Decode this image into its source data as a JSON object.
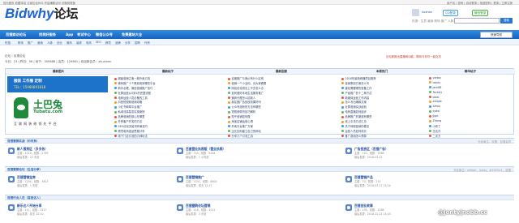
{
  "topbar": {
    "left": "设为首页  收藏本站  订阅论坛RSS  开启辅助访问  切换到宽版",
    "right": "用户名  |  密码  |  自动登录  |  找回密码  |  登录  |  立即注册"
  },
  "logo": {
    "brand": "Bidwhy",
    "suffix": "论坛"
  },
  "header_actions": {
    "qq_login": "QQ登录",
    "wechat_login": "微信登录",
    "hot_search": "热搜：生意 营销 职场 推广 人脉",
    "search_label": "搜索",
    "user": "liuxhon"
  },
  "nav": {
    "items": [
      "百搜商访论坛",
      "找到好服务",
      "App",
      "考试中心",
      "微信公众号",
      "免费建站大全"
    ],
    "right_button": "快速导航"
  },
  "subnav": {
    "items": [
      "热搜：",
      "职场",
      "推广",
      "营销",
      "人脉",
      "创业",
      "微商",
      "装修",
      "电商",
      "SEO",
      "跨境",
      "品牌",
      "分享",
      "招聘",
      "外贸"
    ]
  },
  "breadcrumb": "论坛 › 百搜论坛",
  "stats": "今日：23  |  昨日：56  |  帖子：309888  |  会员：129861  |  欢迎新会员：zhuichen",
  "right_notice": "论坛新推出直播间功能，期待与你们一起交流",
  "panel": {
    "col1": "最新图片",
    "col2": "最新帖子",
    "col3": "最新回复",
    "col4": "本周热门",
    "col5": "精华帖子",
    "ad_title": "服装 工作服 定制",
    "ad_phone": "TEL：15980891818",
    "brand_cn": "土巴兔",
    "brand_en": "Tubatu.com",
    "brand_slogan": "互 联 网 装 修 领 先 平 台"
  },
  "latest_posts": [
    "超级营销之第一款外卖引流",
    "微商推广十个策划用到哪些平台",
    "新手必看，微信营销推广技巧",
    "社群运营从0到1的完整流程",
    "电商运营人员必备的工具",
    "抖音短视频营销攻略",
    "小红书种草平台推广",
    "私域流量裂变实操案例",
    "品牌营销的核心在哪里",
    "外贸客户开发的方法",
    "SEO优化关键词布局技巧",
    "跨境电商选品思路分享",
    "线下门店引流的几种玩法"
  ],
  "latest_replies": [
    "百度推广与竞价有什么区别",
    "营销一个小活动，请大家看看",
    "网站优化排名上不去怎么办",
    "如何做好本地生活服务推广",
    "微商代理怎么招到人",
    "朋友圈广告投放效果好吗",
    "公众号涨粉的方法有哪些",
    "短视频带货技巧解析",
    "知乎营销如何做",
    "淘宝店铺运营心得",
    "外卖平台推广方案",
    "企业如何建立自己的网站",
    "分享几个引流工具"
  ],
  "weekly_hot": [
    "2018年最新网赚项目推荐",
    "营销策划方案怎么写",
    "建站需要哪些准备工作",
    "产品推广的十二种方法",
    "新媒体运营工作内容",
    "怎么写出爆款文案",
    "社群营销实战经验",
    "电商直播如何起步",
    "品牌推广的渠道有哪些",
    "线上引流方法汇总",
    "关于网络营销的看法",
    "运营人员如何成长",
    "推广费用怎么预算"
  ],
  "featured": [
    "yanbo",
    "tatyty",
    "jack88",
    "Tech01",
    "ideal",
    "zshjwe",
    "zzhou",
    "sydw",
    "jjppl",
    "Zhang",
    "小布丁",
    "无名氏",
    "二次方"
  ],
  "sections": [
    {
      "title": "百搜营销实战（中关系）",
      "mods": "分区版主：百搜、百搜会员"
    },
    {
      "title": "百搜营销论坛（生活分享）",
      "mods": "分区版主：zeleph、lcedu、#1303×1，百搜"
    },
    {
      "title": "百搜行业人在（喜爱达人）",
      "mods": ""
    }
  ],
  "forums": [
    [
      {
        "name": "新人报到区（多多务）",
        "stat": "主题：4319，帖数：2765",
        "last": "最后发表：22 天前"
      },
      {
        "name": "百度营业执照版（营业执照）",
        "stat": "主题：743，帖数：6184",
        "last": "最后发表：1 小时前"
      },
      {
        "name": "广告投放区（百搜广告）",
        "stat": "主题：192，帖数：1066",
        "last": "最后发表：2018-03-12"
      }
    ],
    [
      {
        "name": "百搜营销宝库",
        "stat": "主题：1294，帖数：3813",
        "last": "最后发表：1 天前"
      },
      {
        "name": "百搜营销推广",
        "stat": "主题：1531，帖数：8800",
        "last": "最后发表：前天 12:27"
      },
      {
        "name": "百搜营销产品",
        "stat": "主题：70，帖数：270",
        "last": "最后发表：2018-03-17 15:14"
      }
    ],
    [
      {
        "name": "新乐达人开始分享",
        "stat": "主题：411，帖数：1517",
        "last": "最后发表：前天 22:10"
      },
      {
        "name": "百搜圈购论坛营销",
        "stat": "主题：418，帖数：1011",
        "last": "最后发表：3 天前"
      },
      {
        "name": "百搜创业故事",
        "stat": "主题：235，帖数：1268",
        "last": "最后发表：2018-12-12 14:43"
      }
    ]
  ],
  "watermark": "@Jonty|nobb.cc",
  "colors": {
    "nav": "#1763bf",
    "accent": "#1b64d2",
    "panel_border": "#c6d7ec",
    "brand_green": "#1e8a3a"
  }
}
